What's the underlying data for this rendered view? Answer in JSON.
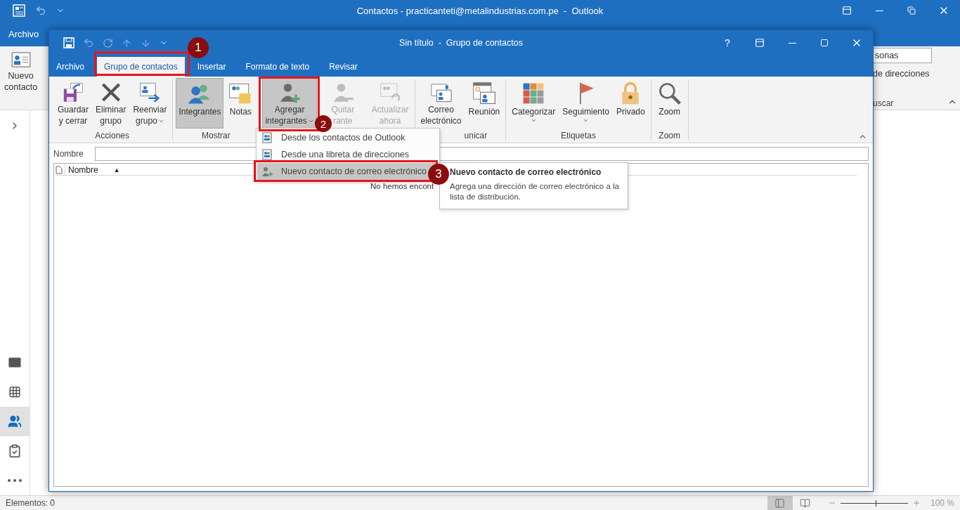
{
  "outlook_window": {
    "title": "Contactos - practicanteti@metalindustrias.com.pe  -  Outlook",
    "tabs": [
      {
        "label": "Archivo",
        "selected": false
      }
    ],
    "ribbon": {
      "new_contact": [
        "Nuevo",
        "contacto"
      ],
      "search_value": "sonas",
      "address_book_link": "de direcciones",
      "search_group_label": "uscar"
    },
    "nav": [
      {
        "kind": "mail",
        "selected": false
      },
      {
        "kind": "calendar",
        "selected": false
      },
      {
        "kind": "people",
        "selected": true
      },
      {
        "kind": "tasks",
        "selected": false
      },
      {
        "kind": "more",
        "selected": false
      }
    ],
    "status_bar": {
      "items": "Elementos: 0",
      "views": [
        {
          "kind": "normal",
          "selected": true
        },
        {
          "kind": "reading",
          "selected": false
        }
      ],
      "zoom": {
        "level": 0.52,
        "reading": "100 %"
      }
    }
  },
  "dialog": {
    "title": "Sin título  -  Grupo de contactos",
    "help": "?",
    "tabs": [
      {
        "label": "Archivo",
        "selected": false
      },
      {
        "label": "Grupo de contactos",
        "selected": true
      },
      {
        "label": "Insertar",
        "selected": false
      },
      {
        "label": "Formato de texto",
        "selected": false
      },
      {
        "label": "Revisar",
        "selected": false
      }
    ],
    "ribbon_groups": [
      {
        "label": "Acciones",
        "buttons": [
          {
            "kind": "save",
            "lines": [
              "Guardar",
              "y cerrar"
            ],
            "selected": false,
            "disabled": false,
            "dropdown": false
          },
          {
            "kind": "delete",
            "lines": [
              "Eliminar",
              "grupo"
            ],
            "selected": false,
            "disabled": false,
            "dropdown": false
          },
          {
            "kind": "forward",
            "lines": [
              "Reenviar",
              "grupo"
            ],
            "selected": false,
            "disabled": false,
            "dropdown": true
          }
        ]
      },
      {
        "label": "Mostrar",
        "buttons": [
          {
            "kind": "members",
            "lines": [
              "Integrantes"
            ],
            "selected": true,
            "disabled": false,
            "dropdown": false
          },
          {
            "kind": "notes",
            "lines": [
              "Notas"
            ],
            "selected": false,
            "disabled": false,
            "dropdown": false
          }
        ]
      },
      {
        "buttons": [
          {
            "kind": "add",
            "lines": [
              "Agregar",
              "integrantes"
            ],
            "selected": true,
            "disabled": false,
            "dropdown": true
          },
          {
            "kind": "remove",
            "lines": [
              "Quitar",
              "rante"
            ],
            "selected": false,
            "disabled": true,
            "dropdown": false
          },
          {
            "kind": "refresh",
            "lines": [
              "Actualizar",
              "ahora"
            ],
            "selected": false,
            "disabled": true,
            "dropdown": false
          }
        ]
      },
      {
        "label": "unicar",
        "buttons": [
          {
            "kind": "email",
            "lines": [
              "Correo",
              "electrónico"
            ],
            "selected": false,
            "disabled": false,
            "dropdown": false
          },
          {
            "kind": "meeting",
            "lines": [
              "Reunión"
            ],
            "selected": false,
            "disabled": false,
            "dropdown": false
          }
        ]
      },
      {
        "label": "Etiquetas",
        "buttons": [
          {
            "kind": "categorize",
            "lines": [
              "Categorizar"
            ],
            "selected": false,
            "disabled": false,
            "dropdown": true
          },
          {
            "kind": "followup",
            "lines": [
              "Seguimiento"
            ],
            "selected": false,
            "disabled": false,
            "dropdown": true
          },
          {
            "kind": "private",
            "lines": [
              "Privado"
            ],
            "selected": false,
            "disabled": false,
            "dropdown": false
          }
        ]
      },
      {
        "label": "Zoom",
        "buttons": [
          {
            "kind": "zoom",
            "lines": [
              "Zoom"
            ],
            "selected": false,
            "disabled": false,
            "dropdown": false
          }
        ]
      }
    ],
    "name_field": {
      "label": "Nombre"
    },
    "members_list": {
      "columns": [
        {
          "label": "Nombre",
          "sort_mark": "▲"
        }
      ],
      "empty_message": "No hemos encont"
    },
    "add_menu": {
      "items": [
        {
          "kind": "contacts",
          "label": "Desde los contactos de Outlook",
          "selected": false
        },
        {
          "kind": "address_book",
          "label": "Desde una libreta de direcciones",
          "selected": false
        },
        {
          "kind": "new_contact",
          "label": "Nuevo contacto de correo electrónico",
          "selected": true
        }
      ]
    },
    "tooltip": {
      "title": "Nuevo contacto de correo electrónico",
      "body": "Agrega una dirección de correo electrónico a la lista de distribución."
    }
  },
  "callouts": [
    {
      "number": "1"
    },
    {
      "number": "2"
    },
    {
      "number": "3"
    }
  ]
}
